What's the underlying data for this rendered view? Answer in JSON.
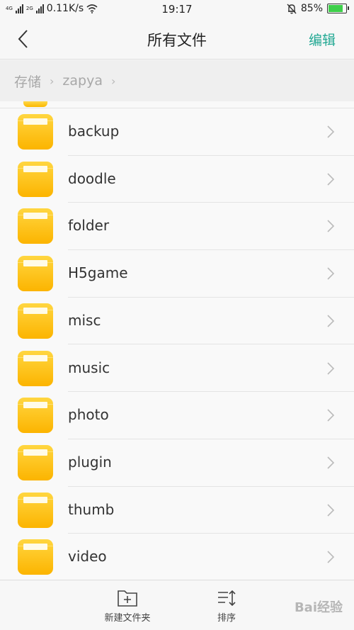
{
  "status_bar": {
    "net1": "4G",
    "net2": "2G",
    "speed": "0.11K/s",
    "time": "19:17",
    "battery": "85%",
    "battery_level": 0.85
  },
  "header": {
    "title": "所有文件",
    "edit_label": "编辑"
  },
  "breadcrumb": {
    "items": [
      "存储",
      "zapya"
    ]
  },
  "folders": [
    {
      "name": "backup"
    },
    {
      "name": "doodle"
    },
    {
      "name": "folder"
    },
    {
      "name": "H5game"
    },
    {
      "name": "misc"
    },
    {
      "name": "music"
    },
    {
      "name": "photo"
    },
    {
      "name": "plugin"
    },
    {
      "name": "thumb"
    },
    {
      "name": "video"
    }
  ],
  "bottom_bar": {
    "new_folder_label": "新建文件夹",
    "sort_label": "排序"
  },
  "watermark": "Bai经验",
  "colors": {
    "accent": "#22a893",
    "folder": "#fcb400",
    "battery": "#3ecf4a"
  }
}
